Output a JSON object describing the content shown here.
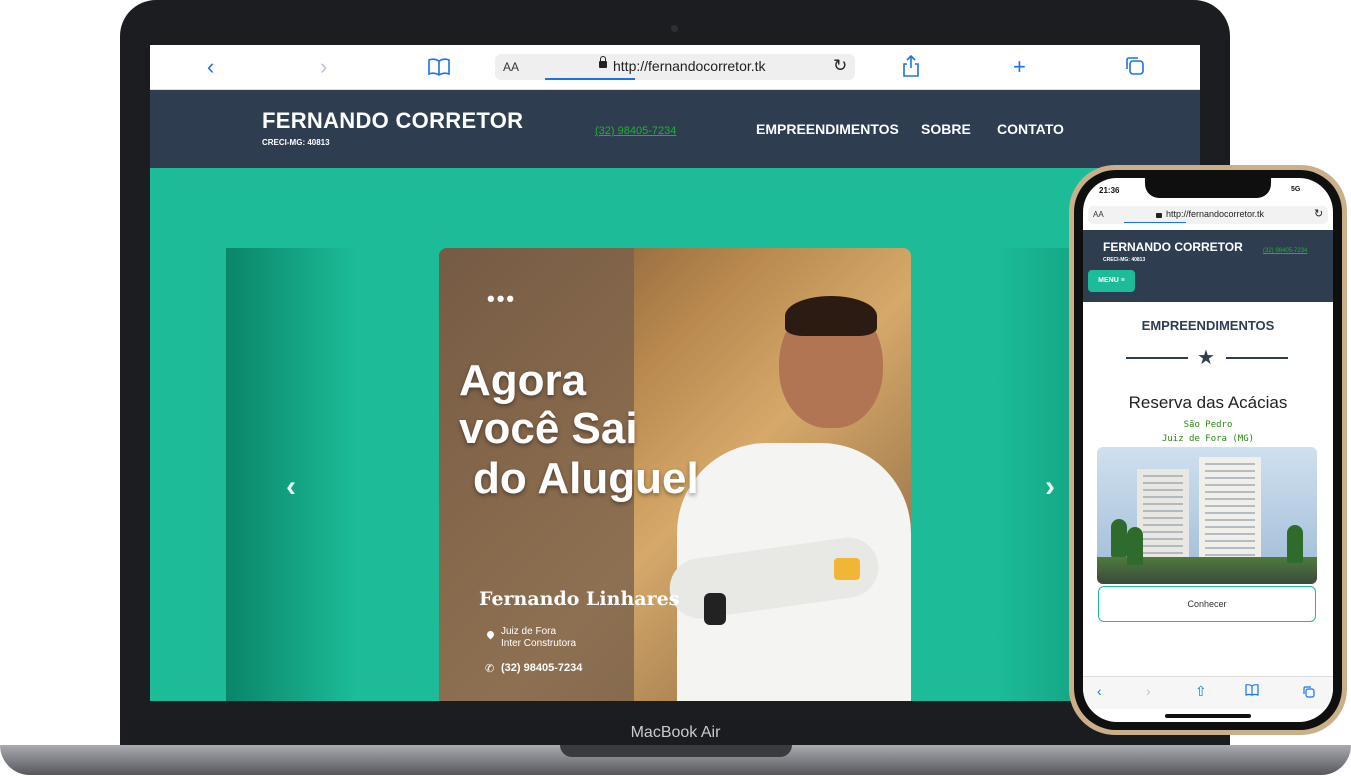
{
  "laptop": {
    "model_label": "MacBook Air",
    "browser": {
      "url_prefix": "AA",
      "url": "http://fernandocorretor.tk",
      "icons": [
        "back-icon",
        "forward-icon",
        "bookmarks-icon",
        "reload-icon",
        "share-icon",
        "new-tab-icon",
        "tabs-icon"
      ]
    },
    "site": {
      "brand": "FERNANDO CORRETOR",
      "creci": "CRECI-MG: 40813",
      "phone": "(32) 98405-7234",
      "nav": [
        "EMPREENDIMENTOS",
        "SOBRE",
        "CONTATO"
      ],
      "colors": {
        "header": "#2e3e50",
        "accent": "#1cbc98",
        "phone_link": "#1cb32f"
      }
    },
    "carousel": {
      "prev_arrow": "‹",
      "next_arrow": "›",
      "slide": {
        "headline_lines": [
          "Agora",
          "você Sai",
          "do Aluguel"
        ],
        "name": "Fernando Linhares",
        "location_line1": "Juiz de Fora",
        "location_line2": "Inter Construtora",
        "phone": "(32) 98405-7234"
      }
    }
  },
  "phone_device": {
    "status": {
      "time": "21:36",
      "network": "5G"
    },
    "browser": {
      "url_prefix": "AA",
      "url": "http://fernandocorretor.tk"
    },
    "site": {
      "brand": "FERNANDO CORRETOR",
      "creci": "CRECI-MG: 40813",
      "phone": "(32) 98405-7234",
      "menu_label": "MENU ≡",
      "section_title": "EMPREENDIMENTOS",
      "listing": {
        "title": "Reserva das Acácias",
        "neighborhood": "São Pedro",
        "city": "Juiz de Fora (MG)",
        "button": "Conhecer"
      }
    }
  }
}
